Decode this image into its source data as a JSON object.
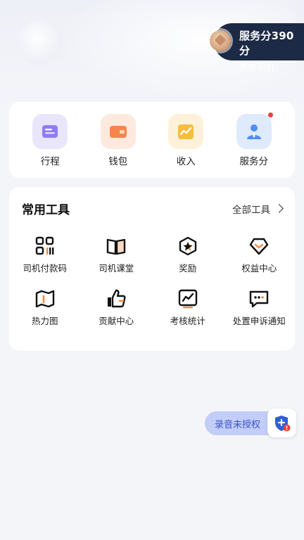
{
  "service_badge": {
    "score_text": "服务分390分",
    "level": "黄金司机"
  },
  "top_actions": [
    {
      "label": "行程",
      "icon": "trip-icon"
    },
    {
      "label": "钱包",
      "icon": "wallet-icon"
    },
    {
      "label": "收入",
      "icon": "income-icon"
    },
    {
      "label": "服务分",
      "icon": "service-score-icon",
      "has_dot": true
    }
  ],
  "tools": {
    "title": "常用工具",
    "all_label": "全部工具",
    "items": [
      {
        "label": "司机付款码",
        "icon": "payment-code-icon"
      },
      {
        "label": "司机课堂",
        "icon": "book-icon"
      },
      {
        "label": "奖励",
        "icon": "reward-icon"
      },
      {
        "label": "权益中心",
        "icon": "benefit-tag-icon"
      },
      {
        "label": "热力图",
        "icon": "heatmap-icon"
      },
      {
        "label": "贡献中心",
        "icon": "thumbs-up-icon"
      },
      {
        "label": "考核统计",
        "icon": "stats-chart-icon"
      },
      {
        "label": "处置申诉通知",
        "icon": "message-icon"
      }
    ]
  },
  "floating": {
    "record_label": "录音未授权",
    "shield_icon": "shield-alert-icon"
  },
  "colors": {
    "badge_bg": "#1d2a45",
    "record_pill_bg": "#c2cdf8",
    "alert_red": "#e8403a"
  }
}
